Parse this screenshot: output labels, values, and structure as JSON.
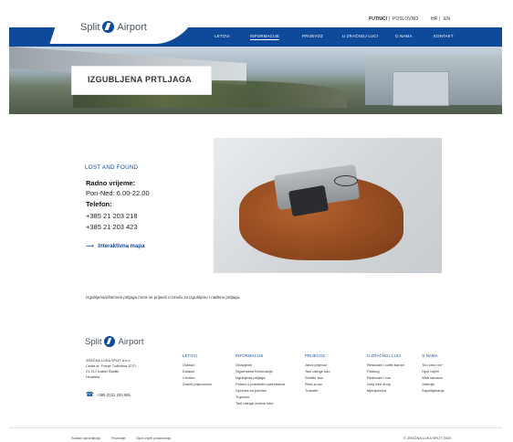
{
  "header": {
    "logo_text_left": "Split",
    "logo_text_right": "Airport",
    "util_lang_label": "PUTNICI",
    "util_separator": "|",
    "util_business": "POSLOVNO",
    "util_lang_hr": "HR",
    "util_lang_sep": "|",
    "util_lang_en": "EN",
    "nav": [
      "LETOVI",
      "INFORMACIJE",
      "PRIJEVOZ",
      "U ZRAČNOJ LUCI",
      "O NAMA",
      "KONTAKT"
    ],
    "active_nav_index": 1
  },
  "hero": {
    "title": "IZGUBLJENA PRTLJAGA"
  },
  "content": {
    "section_title": "LOST AND FOUND",
    "hours_label": "Radno vrijeme:",
    "hours_value": "Pon-Ned: 6.00-22.00",
    "phone_label": "Telefon:",
    "phone_1": "+385 21 203 218",
    "phone_2": "+385 21 203 423",
    "map_arrow": "⟶",
    "map_link": "Interaktivna mapa",
    "caption": "Izgubljena/oštećena prtljaga mora se prijaviti u Uredu za izgubljenu i nađenu prtljagu."
  },
  "footer": {
    "logo_text_left": "Split",
    "logo_text_right": "Airport",
    "address": [
      "ZRAČNA LUKA SPLIT d.o.o.",
      "Cesta dr. Franje Tuđmana 1270",
      "21 217 Kaštel Štafilić",
      "Hrvatska"
    ],
    "phone_icon": "☎",
    "phone": "+385 (0)21 203 555",
    "columns": [
      {
        "title": "LETOVI",
        "items": [
          "Odlasci",
          "Dolasci",
          "Chciton",
          "Zračni prijevoznici"
        ]
      },
      {
        "title": "INFORMACIJE",
        "items": [
          "Obavijesti",
          "Sigurnosne informacije",
          "Izgubljena prtljaga",
          "Putnici s posebnim potrebama",
          "Oprema za putnike",
          "Trgovine",
          "Taxi usluge zračne luke"
        ]
      },
      {
        "title": "PRIJEVOZ",
        "items": [
          "Javni prijevoz",
          "Taxi usluge kao",
          "Shuttle bus",
          "Rent-a-car",
          "Transfer"
        ]
      },
      {
        "title": "U ZRAČNOJ LUCI",
        "items": [
          "Restorani i caffe barovi",
          "Parking",
          "Restorani i bar",
          "Duty free shop",
          "Mjenjačnica"
        ]
      },
      {
        "title": "O NAMA",
        "items": [
          "Tko smo mi?",
          "Opći uvjeti",
          "Web kamera",
          "Galerija",
          "Zapošljavanje"
        ]
      }
    ],
    "bottom_links": [
      "Sustav upravljanja",
      "Financije",
      "Opći uvjeti poslovanja"
    ],
    "copyright": "© ZRAČNA LUKA SPLIT 2020"
  },
  "colors": {
    "brand_blue": "#0f4a9a",
    "text": "#222222"
  },
  "icons": [
    "logo-mark-icon",
    "arrow-right-icon",
    "phone-icon"
  ]
}
